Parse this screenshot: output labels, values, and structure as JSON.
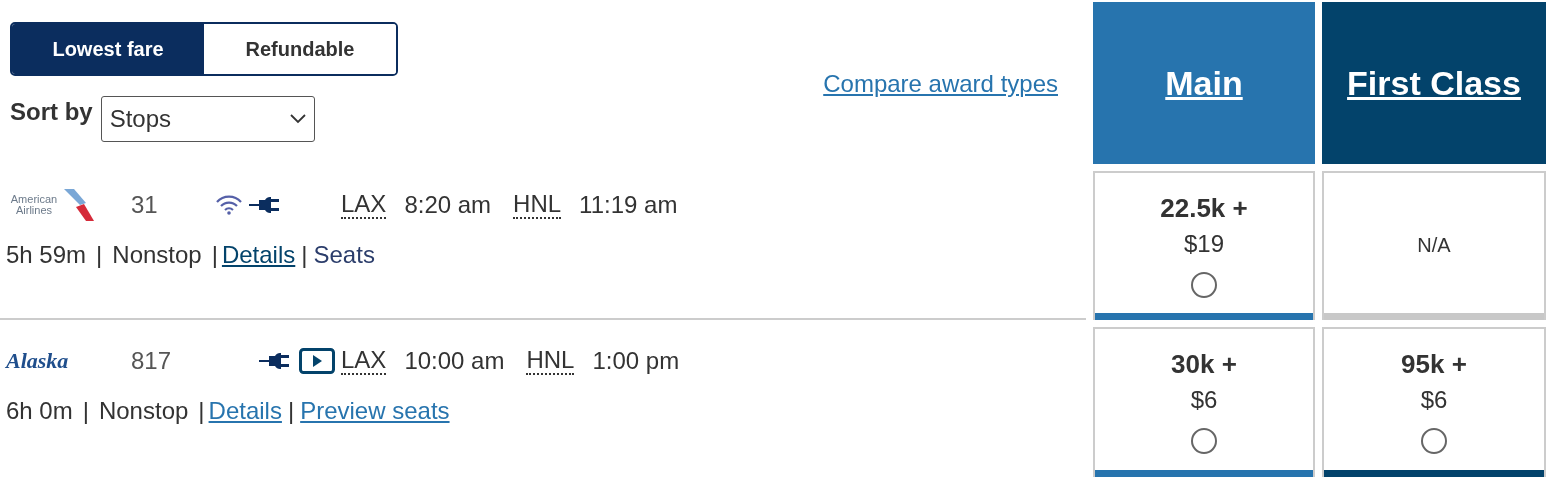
{
  "fare_toggle": [
    {
      "label": "Lowest fare",
      "selected": true
    },
    {
      "label": "Refundable",
      "selected": false
    }
  ],
  "sort": {
    "label": "Sort by",
    "value": "Stops"
  },
  "compare_link": "Compare award types",
  "columns": [
    {
      "label": "Main",
      "color": "#2774ae"
    },
    {
      "label": "First Class",
      "color": "#03436b"
    }
  ],
  "flights": [
    {
      "airline": {
        "kind": "american",
        "logo_text": "American Airlines"
      },
      "number": "31",
      "amenities": [
        {
          "kind": "wifi"
        },
        {
          "kind": "power"
        }
      ],
      "from": "LAX",
      "depart": "8:20 am",
      "to": "HNL",
      "arrive": "11:19 am",
      "duration": "5h 59m",
      "separator_1": "|",
      "stops": "Nonstop",
      "links": [
        {
          "separator": "|",
          "label": "Details",
          "color": "#03436b",
          "underlined": true
        },
        {
          "separator": "|",
          "label": "Seats",
          "color": "#2b3d6b",
          "underlined": false
        }
      ],
      "fares": [
        {
          "available": true,
          "miles": "22.5k +",
          "price": "$19",
          "selected": false
        },
        {
          "available": false,
          "text": "N/A"
        }
      ]
    },
    {
      "airline": {
        "kind": "alaska",
        "logo_text": "Alaska"
      },
      "number": "817",
      "amenities": [
        {
          "kind": "power"
        },
        {
          "kind": "video"
        }
      ],
      "from": "LAX",
      "depart": "10:00 am",
      "to": "HNL",
      "arrive": "1:00 pm",
      "duration": "6h 0m",
      "separator_1": "|",
      "stops": "Nonstop",
      "links": [
        {
          "separator": "|",
          "label": "Details",
          "color": "#2774ae",
          "underlined": true
        },
        {
          "separator": "|",
          "label": "Preview seats",
          "color": "#2774ae",
          "underlined": true
        }
      ],
      "fares": [
        {
          "available": true,
          "miles": "30k +",
          "price": "$6",
          "selected": false
        },
        {
          "available": true,
          "miles": "95k +",
          "price": "$6",
          "selected": false
        }
      ]
    }
  ]
}
